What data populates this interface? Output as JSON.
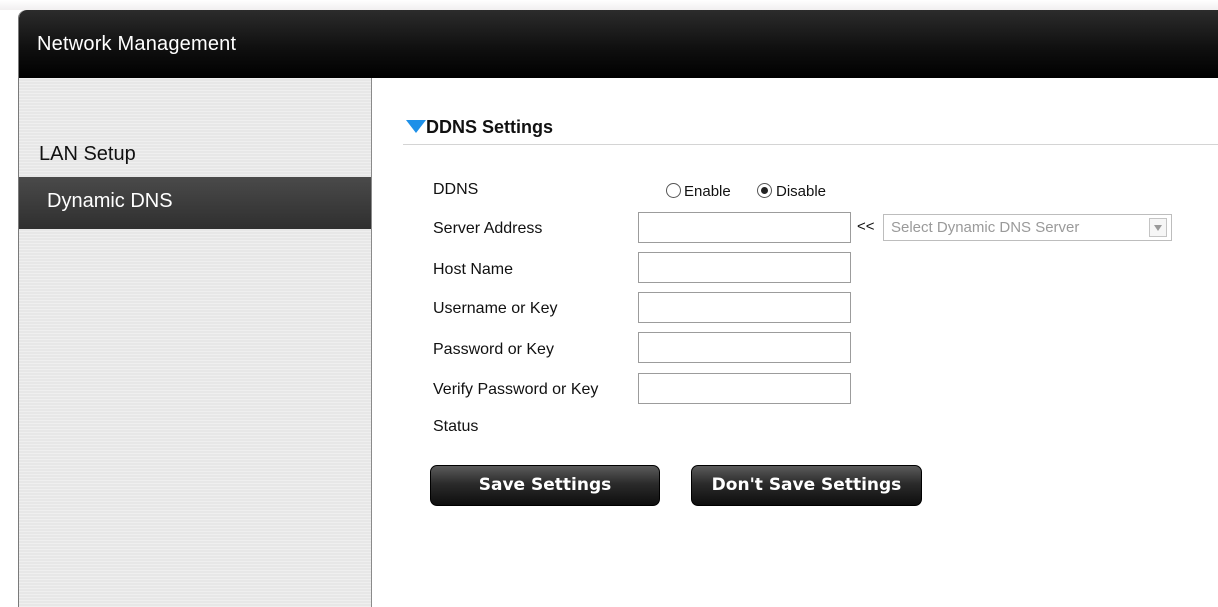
{
  "window": {
    "title": "Network Management"
  },
  "sidebar": {
    "items": [
      {
        "label": "LAN Setup",
        "active": false
      },
      {
        "label": "Dynamic DNS",
        "active": true
      }
    ]
  },
  "main": {
    "section_title": "DDNS Settings",
    "form": {
      "ddns_label": "DDNS",
      "enable_label": "Enable",
      "disable_label": "Disable",
      "ddns_selected": "Disable",
      "server_address_label": "Server Address",
      "server_address_value": "",
      "server_prefix": "<<",
      "server_select_value": "Select Dynamic DNS Server",
      "host_name_label": "Host Name",
      "host_name_value": "",
      "username_label": "Username or Key",
      "username_value": "",
      "password_label": "Password or Key",
      "password_value": "",
      "verify_label": "Verify Password or Key",
      "verify_value": "",
      "status_label": "Status"
    },
    "buttons": {
      "save": "Save Settings",
      "dont_save": "Don't Save Settings"
    }
  },
  "colors": {
    "accent": "#1e90e8",
    "titlebar": "#000000",
    "sidebar_bg": "#e7e7e7",
    "sidebar_active": "#3a3a3a"
  },
  "icons": {
    "section_caret": "triangle-down-icon",
    "select_arrow": "chevron-down-icon"
  }
}
